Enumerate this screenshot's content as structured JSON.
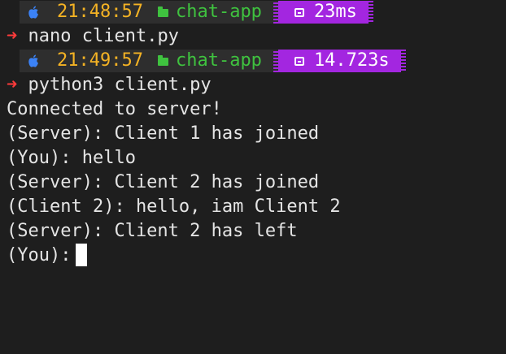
{
  "prompts": [
    {
      "time": "21:48:57",
      "dir": "chat-app",
      "duration": "23ms",
      "arrow": "➜",
      "command": "nano client.py"
    },
    {
      "time": "21:49:57",
      "dir": "chat-app",
      "duration": "14.723s",
      "arrow": "➜",
      "command": "python3 client.py"
    }
  ],
  "output": [
    "Connected to server!",
    "(Server): Client 1 has joined",
    "(You): hello",
    "(Server): Client 2 has joined",
    "(Client 2): hello, iam Client 2",
    "(Server): Client 2 has left"
  ],
  "input_prompt": "(You):",
  "colors": {
    "background": "#1e1e1e",
    "time": "#f5b324",
    "dir": "#3fc23f",
    "duration_bg": "#a326e0",
    "arrow": "#ff3b3b",
    "text": "#e4e4e4"
  },
  "icons": [
    "apple-icon",
    "folder-icon",
    "timer-icon"
  ]
}
